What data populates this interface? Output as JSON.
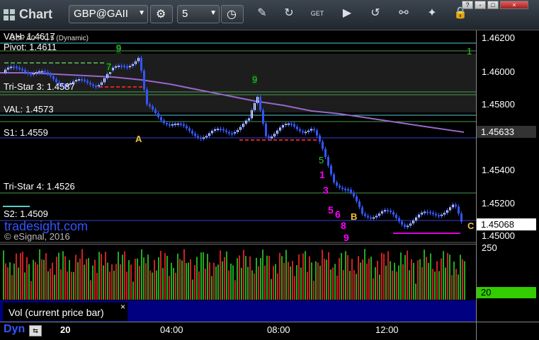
{
  "toolbar": {
    "title": "Chart",
    "symbol": "GBP@GAII",
    "interval": "5"
  },
  "window_buttons": [
    "?",
    "-",
    "□",
    "×"
  ],
  "overlay": {
    "partial_top": "VAH: 1.4617",
    "symbol_desc": "GBP A0-FX, 5 (Dynamic)",
    "watermark": "tradesight.com",
    "copyright": "© eSignal, 2016"
  },
  "levels": [
    {
      "label": "Pivot: 1.4611"
    },
    {
      "label": "Tri-Star 3: 1.4587"
    },
    {
      "label": "VAL: 1.4573"
    },
    {
      "label": "S1: 1.4559"
    },
    {
      "label": "Tri-Star 4: 1.4526"
    },
    {
      "label": "S2: 1.4509"
    }
  ],
  "price_axis": {
    "ticks": [
      "1.46200",
      "1.46000",
      "1.45800",
      "1.45400",
      "1.45200",
      "1.45000"
    ],
    "current_price": "1.45633",
    "last_price": "1.45068"
  },
  "volume_pane": {
    "title": "Vol (current price bar)",
    "axis_top": "250",
    "current_volume": "20",
    "close_label": "×"
  },
  "time_axis": {
    "mode": "Dyn",
    "date": "20",
    "ticks": [
      "04:00",
      "08:00",
      "12:00"
    ]
  },
  "annotations": {
    "letters": [
      "A",
      "B",
      "C"
    ],
    "magenta_counts": [
      "1",
      "3",
      "5",
      "6",
      "8",
      "9"
    ],
    "green_counts": [
      "9",
      "7",
      "5",
      "1"
    ]
  },
  "colors": {
    "price_bars": "#3355ff",
    "up_candles": "#ffffff",
    "moving_average": "#9966cc",
    "level_lines": "#4a9a4a",
    "pivot_line": "#55cccc",
    "support_line": "#3344cc",
    "red_dashes": "#dd2222",
    "magenta_counts": "#ff00ff",
    "volume_bar_pane": "#000088",
    "current_price_box": "#333333",
    "current_volume_box": "#33cc00"
  }
}
